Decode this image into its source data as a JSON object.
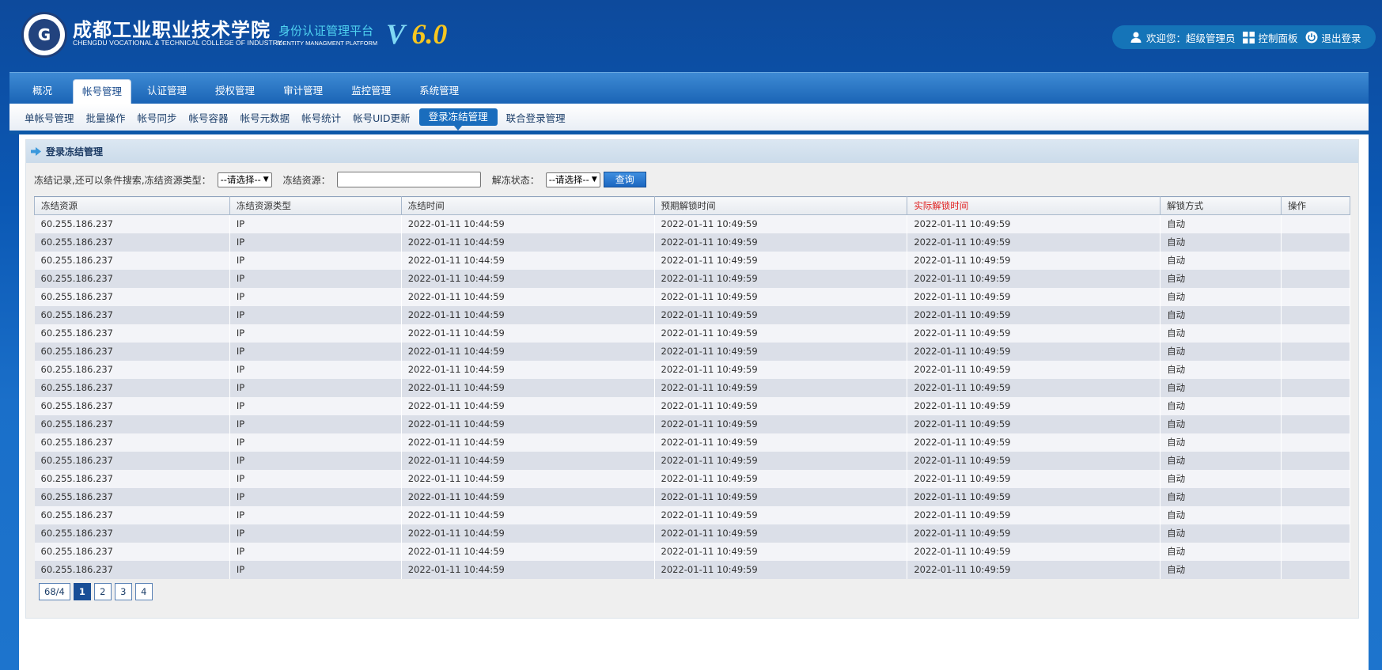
{
  "header": {
    "logo_text": "G",
    "school_cn": "成都工业职业技术学院",
    "platform_cn": "身份认证管理平台",
    "school_en": "CHENGDU VOCATIONAL & TECHNICAL COLLEGE OF INDUSTRY",
    "platform_en": "IDENTITY MANAGMENT PLATFORM",
    "version_v": "V",
    "version_num": "6.0",
    "welcome": "欢迎您：超级管理员",
    "dashboard": "控制面板",
    "logout": "退出登录"
  },
  "nav": {
    "tabs": [
      "概况",
      "帐号管理",
      "认证管理",
      "授权管理",
      "审计管理",
      "监控管理",
      "系统管理"
    ],
    "active": "帐号管理"
  },
  "subnav": {
    "items": [
      "单帐号管理",
      "批量操作",
      "帐号同步",
      "帐号容器",
      "帐号元数据",
      "帐号统计",
      "帐号UID更新",
      "登录冻结管理",
      "联合登录管理"
    ],
    "active": "登录冻结管理"
  },
  "panel": {
    "title": "登录冻结管理"
  },
  "filters": {
    "type_label": "冻结记录,还可以条件搜索,冻结资源类型：",
    "type_value": "--请选择--",
    "resource_label": "冻结资源：",
    "resource_value": "",
    "status_label": "解冻状态：",
    "status_value": "--请选择--",
    "query_button": "查询"
  },
  "table": {
    "headers": [
      "冻结资源",
      "冻结资源类型",
      "冻结时间",
      "预期解锁时间",
      "实际解锁时间",
      "解锁方式",
      "操作"
    ],
    "rows": [
      [
        "60.255.186.237",
        "IP",
        "2022-01-11 10:44:59",
        "2022-01-11 10:49:59",
        "2022-01-11 10:49:59",
        "自动",
        ""
      ],
      [
        "60.255.186.237",
        "IP",
        "2022-01-11 10:44:59",
        "2022-01-11 10:49:59",
        "2022-01-11 10:49:59",
        "自动",
        ""
      ],
      [
        "60.255.186.237",
        "IP",
        "2022-01-11 10:44:59",
        "2022-01-11 10:49:59",
        "2022-01-11 10:49:59",
        "自动",
        ""
      ],
      [
        "60.255.186.237",
        "IP",
        "2022-01-11 10:44:59",
        "2022-01-11 10:49:59",
        "2022-01-11 10:49:59",
        "自动",
        ""
      ],
      [
        "60.255.186.237",
        "IP",
        "2022-01-11 10:44:59",
        "2022-01-11 10:49:59",
        "2022-01-11 10:49:59",
        "自动",
        ""
      ],
      [
        "60.255.186.237",
        "IP",
        "2022-01-11 10:44:59",
        "2022-01-11 10:49:59",
        "2022-01-11 10:49:59",
        "自动",
        ""
      ],
      [
        "60.255.186.237",
        "IP",
        "2022-01-11 10:44:59",
        "2022-01-11 10:49:59",
        "2022-01-11 10:49:59",
        "自动",
        ""
      ],
      [
        "60.255.186.237",
        "IP",
        "2022-01-11 10:44:59",
        "2022-01-11 10:49:59",
        "2022-01-11 10:49:59",
        "自动",
        ""
      ],
      [
        "60.255.186.237",
        "IP",
        "2022-01-11 10:44:59",
        "2022-01-11 10:49:59",
        "2022-01-11 10:49:59",
        "自动",
        ""
      ],
      [
        "60.255.186.237",
        "IP",
        "2022-01-11 10:44:59",
        "2022-01-11 10:49:59",
        "2022-01-11 10:49:59",
        "自动",
        ""
      ],
      [
        "60.255.186.237",
        "IP",
        "2022-01-11 10:44:59",
        "2022-01-11 10:49:59",
        "2022-01-11 10:49:59",
        "自动",
        ""
      ],
      [
        "60.255.186.237",
        "IP",
        "2022-01-11 10:44:59",
        "2022-01-11 10:49:59",
        "2022-01-11 10:49:59",
        "自动",
        ""
      ],
      [
        "60.255.186.237",
        "IP",
        "2022-01-11 10:44:59",
        "2022-01-11 10:49:59",
        "2022-01-11 10:49:59",
        "自动",
        ""
      ],
      [
        "60.255.186.237",
        "IP",
        "2022-01-11 10:44:59",
        "2022-01-11 10:49:59",
        "2022-01-11 10:49:59",
        "自动",
        ""
      ],
      [
        "60.255.186.237",
        "IP",
        "2022-01-11 10:44:59",
        "2022-01-11 10:49:59",
        "2022-01-11 10:49:59",
        "自动",
        ""
      ],
      [
        "60.255.186.237",
        "IP",
        "2022-01-11 10:44:59",
        "2022-01-11 10:49:59",
        "2022-01-11 10:49:59",
        "自动",
        ""
      ],
      [
        "60.255.186.237",
        "IP",
        "2022-01-11 10:44:59",
        "2022-01-11 10:49:59",
        "2022-01-11 10:49:59",
        "自动",
        ""
      ],
      [
        "60.255.186.237",
        "IP",
        "2022-01-11 10:44:59",
        "2022-01-11 10:49:59",
        "2022-01-11 10:49:59",
        "自动",
        ""
      ],
      [
        "60.255.186.237",
        "IP",
        "2022-01-11 10:44:59",
        "2022-01-11 10:49:59",
        "2022-01-11 10:49:59",
        "自动",
        ""
      ],
      [
        "60.255.186.237",
        "IP",
        "2022-01-11 10:44:59",
        "2022-01-11 10:49:59",
        "2022-01-11 10:49:59",
        "自动",
        ""
      ]
    ]
  },
  "pager": {
    "info": "68/4",
    "pages": [
      "1",
      "2",
      "3",
      "4"
    ],
    "current": "1"
  },
  "colors": {
    "accent": "#1a6dbd",
    "highlight_header": "#e02020",
    "version_v": "#7fd8f4",
    "version_num": "#f6c620"
  }
}
